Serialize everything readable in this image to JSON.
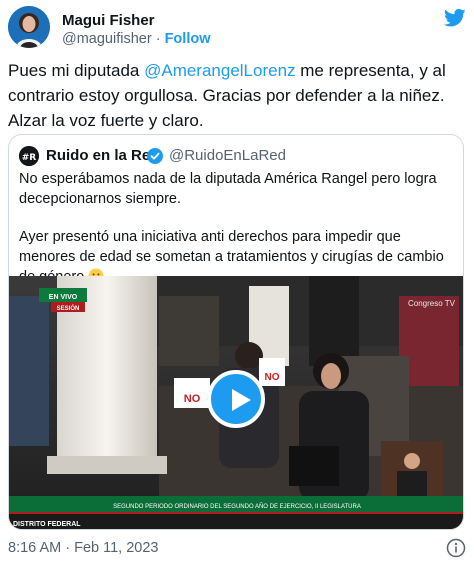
{
  "author": {
    "name": "Magui Fisher",
    "handle": "@maguifisher",
    "separator": "·",
    "follow_label": "Follow"
  },
  "tweet": {
    "text_before": "Pues mi diputada ",
    "mention": "@AmerangelLorenz",
    "text_after": " me representa, y al contrario estoy orgullosa. Gracias por defender a la niñez. Alzar la voz fuerte y claro."
  },
  "quoted": {
    "name": "Ruido en la Red",
    "handle": "@RuidoEnLaRed",
    "paragraph_1": "No esperábamos nada de la diputada América Rangel pero logra decepcionarnos siempre.",
    "paragraph_2": "Ayer presentó una iniciativa anti derechos para impedir que menores de edad se sometan a tratamientos y cirugías de cambio de género"
  },
  "video": {
    "live_badge": "EN VIVO",
    "session_badge": "SESIÓN",
    "channel": "Congreso TV",
    "sign_left": "NO",
    "sign_right": "NO",
    "ticker": "SEGUNDO PERIODO ORDINARIO DEL SEGUNDO AÑO DE EJERCICIO, II LEGISLATURA",
    "location": "DISTRITO FEDERAL"
  },
  "footer": {
    "timestamp": "8:16 AM · Feb 11, 2023"
  },
  "colors": {
    "accent": "#1d9bf0",
    "text": "#0f1419",
    "secondary": "#536471",
    "border": "#cfd9de"
  },
  "icons": [
    "twitter-bird-icon",
    "verified-badge-icon",
    "play-icon",
    "info-icon",
    "thinking-face-emoji"
  ]
}
